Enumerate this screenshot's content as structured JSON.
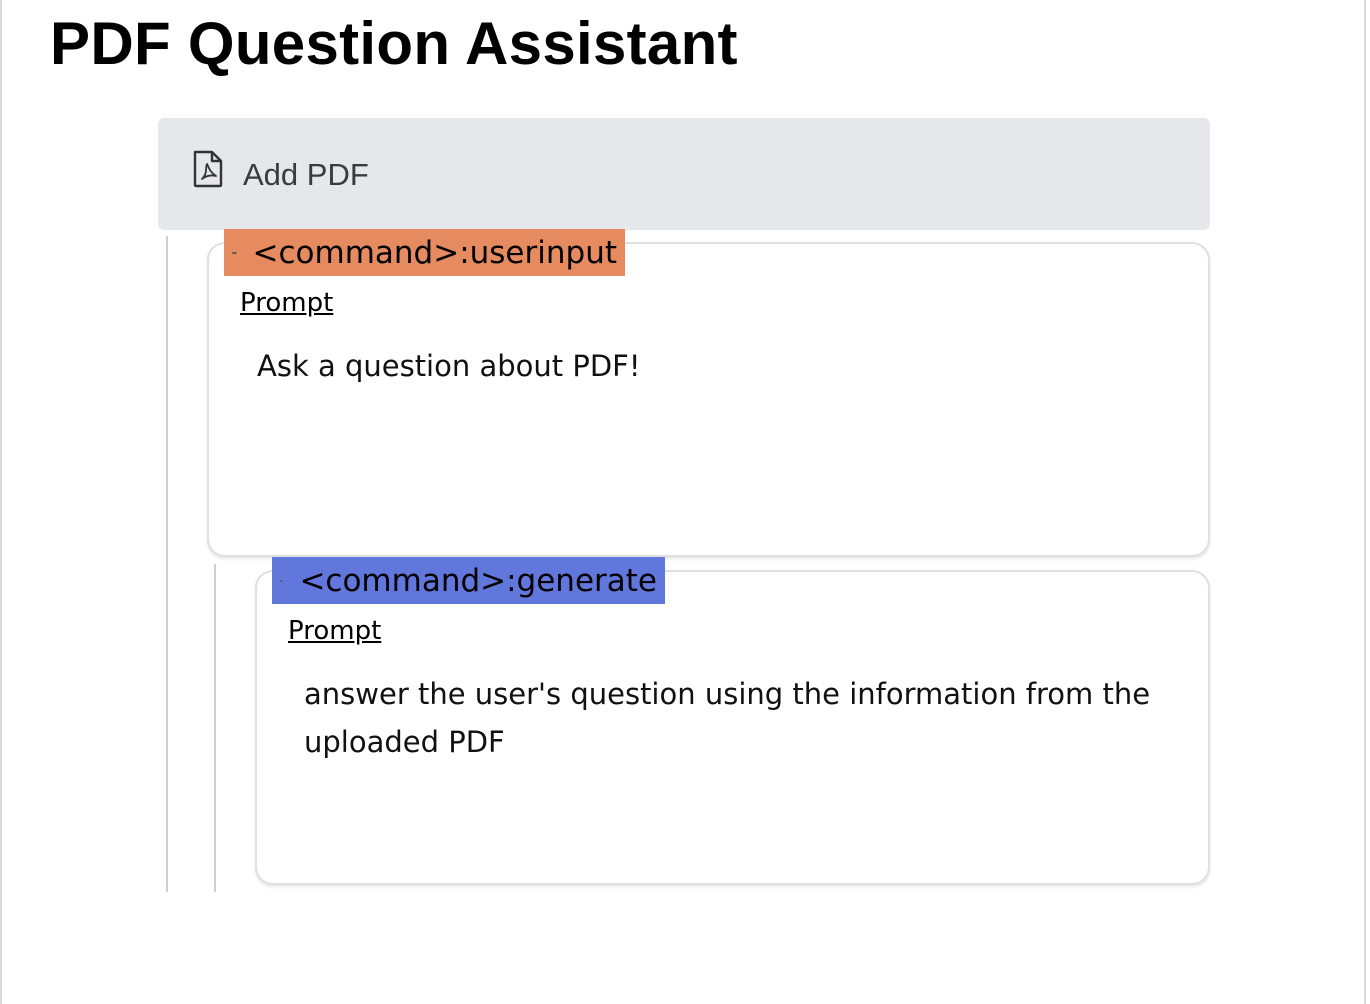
{
  "page": {
    "title": "PDF Question Assistant"
  },
  "add_pdf": {
    "label": "Add PDF",
    "icon": "pdf-file-icon",
    "background": "#e6e7ea"
  },
  "commands": [
    {
      "badge": "<command>:userinput",
      "badge_color": "#e68a60",
      "icon": "eye-icon",
      "prompt_label": "Prompt",
      "prompt_text": "Ask a question about PDF!"
    },
    {
      "badge": "<command>:generate",
      "badge_color": "#6277dc",
      "icon": "eye-icon",
      "prompt_label": "Prompt",
      "prompt_text": "answer the user's question using the information from the uploaded PDF"
    }
  ]
}
